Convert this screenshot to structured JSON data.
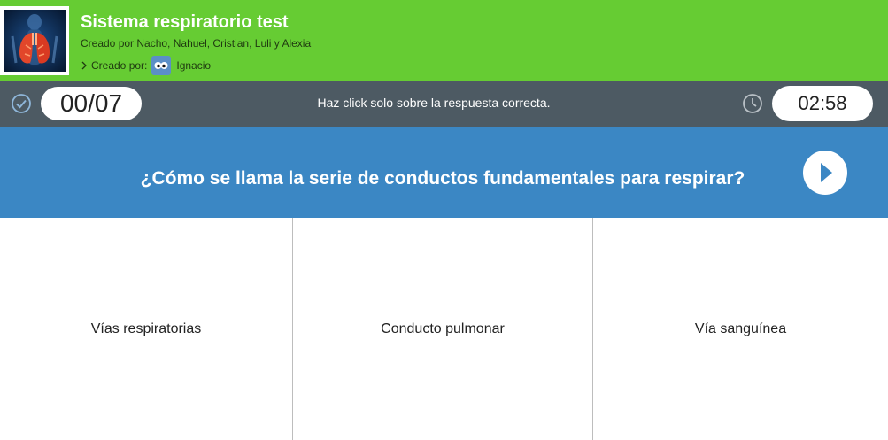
{
  "header": {
    "title": "Sistema respiratorio test",
    "subtitle": "Creado por Nacho, Nahuel, Cristian, Luli y Alexia",
    "creator_label": "Creado por:",
    "creator_name": "Ignacio",
    "thumbnail_icon": "lungs-image",
    "background_color": "#66cc33"
  },
  "status": {
    "score": "00/07",
    "instruction": "Haz click solo sobre la respuesta correcta.",
    "timer": "02:58",
    "check_icon": "check-circle-icon",
    "clock_icon": "clock-icon",
    "background_color": "#4d5a63"
  },
  "question": {
    "text": "¿Cómo se llama la serie de conductos fundamentales para respirar?",
    "next_icon": "play-icon",
    "background_color": "#3b87c4"
  },
  "answers": [
    {
      "label": "Vías respiratorias"
    },
    {
      "label": "Conducto pulmonar"
    },
    {
      "label": "Vía sanguínea"
    }
  ]
}
